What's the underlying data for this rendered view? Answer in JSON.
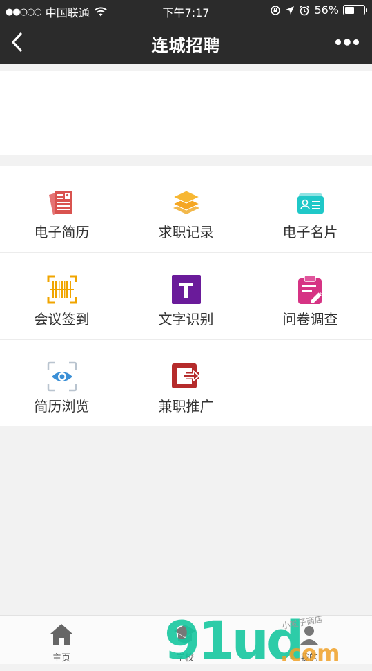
{
  "status_bar": {
    "signal": "●●○○○",
    "carrier": "中国联通",
    "time": "下午7:17",
    "battery_percent": "56%",
    "battery_level": 0.56
  },
  "nav": {
    "title": "连城招聘"
  },
  "grid_items": [
    {
      "label": "电子简历",
      "icon": "resume-icon",
      "color": "#d9534f"
    },
    {
      "label": "求职记录",
      "icon": "layers-icon",
      "color": "#f5a623"
    },
    {
      "label": "电子名片",
      "icon": "business-card-icon",
      "color": "#1fc8c8"
    },
    {
      "label": "会议签到",
      "icon": "barcode-scan-icon",
      "color": "#f0a500"
    },
    {
      "label": "文字识别",
      "icon": "text-recognition-icon",
      "color": "#6a1b9a"
    },
    {
      "label": "问卷调查",
      "icon": "survey-clipboard-icon",
      "color": "#d63384"
    },
    {
      "label": "简历浏览",
      "icon": "eye-scan-icon",
      "color": "#3a8fd6"
    },
    {
      "label": "兼职推广",
      "icon": "share-arrow-icon",
      "color": "#b52b2b"
    }
  ],
  "tabs": [
    {
      "label": "主页",
      "icon": "home-icon"
    },
    {
      "label": "学校",
      "icon": "school-icon"
    },
    {
      "label": "我的",
      "icon": "profile-icon"
    }
  ],
  "watermark": {
    "text": "91ud",
    "suffix": ".com",
    "small": "小啦子商店"
  }
}
